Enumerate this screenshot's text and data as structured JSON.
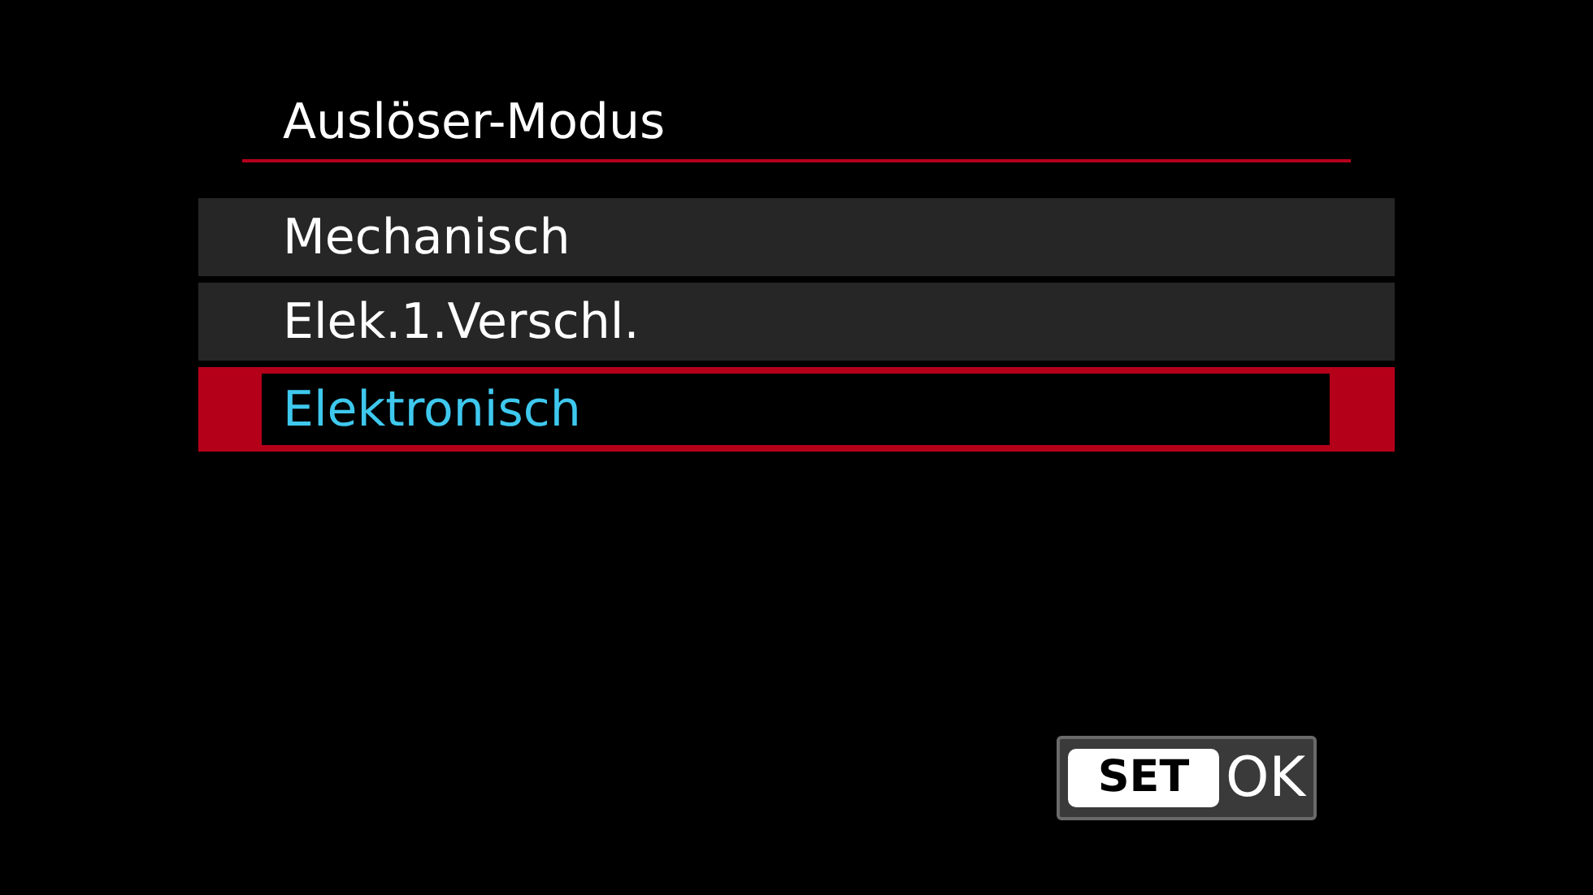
{
  "title": "Auslöser-Modus",
  "options": [
    {
      "label": "Mechanisch",
      "selected": false
    },
    {
      "label": "Elek.1.Verschl.",
      "selected": false
    },
    {
      "label": "Elektronisch",
      "selected": true
    }
  ],
  "confirm": {
    "key": "SET",
    "label": "OK"
  }
}
